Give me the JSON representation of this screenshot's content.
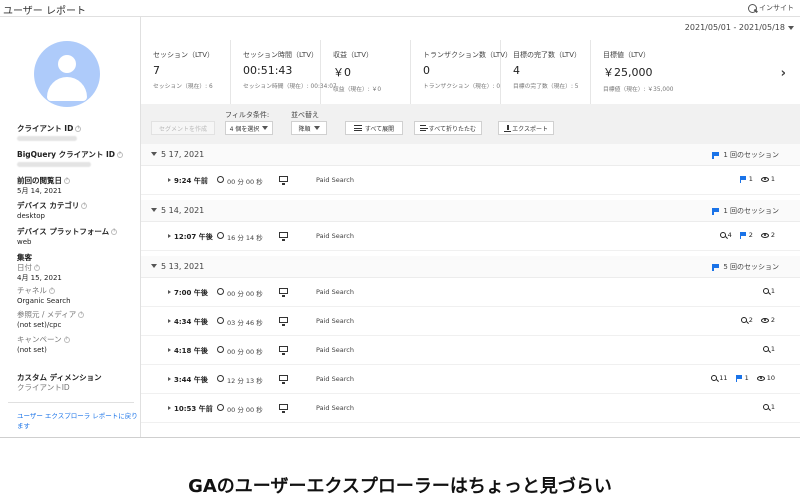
{
  "header": {
    "title": "ユーザー レポート",
    "insight": "インサイト"
  },
  "date_range": "2021/05/01 - 2021/05/18",
  "left_panel": {
    "client_id_label": "クライアント ID",
    "bq_client_id_label": "BigQuery クライアント ID",
    "first_visit_label": "前回の閲覧日",
    "first_visit_value": "5月 14, 2021",
    "device_category_label": "デバイス カテゴリ",
    "device_category_value": "desktop",
    "device_platform_label": "デバイス プラットフォーム",
    "device_platform_value": "web",
    "acquisition_label": "集客",
    "date_label": "日付",
    "date_value": "4月 15, 2021",
    "channel_label": "チャネル",
    "channel_value": "Organic Search",
    "source_medium_label": "参照元 / メディア",
    "source_medium_value": "(not set)/cpc",
    "campaign_label": "キャンペーン",
    "campaign_value": "(not set)",
    "custom_dim_label": "カスタム ディメンション",
    "custom_dim_sub": "クライアントID",
    "back_link": "ユーザー エクスプローラ レポートに戻ります"
  },
  "metrics": [
    {
      "label": "セッション（LTV）",
      "value": "7",
      "sub": "セッション（現在）: 6"
    },
    {
      "label": "セッション時間（LTV）",
      "value": "00:51:43",
      "sub": "セッション時間（現在）: 00:34:07"
    },
    {
      "label": "収益（LTV）",
      "value": "￥0",
      "sub": "収益（現在）: ￥0"
    },
    {
      "label": "トランザクション数（LTV）",
      "value": "0",
      "sub": "トランザクション（現在）: 0"
    },
    {
      "label": "目標の完了数（LTV）",
      "value": "4",
      "sub": "目標の完了数（現在）: 5"
    },
    {
      "label": "目標値（LTV）",
      "value": "￥25,000",
      "sub": "目標値（現在）: ￥35,000"
    }
  ],
  "metrics_next": "›",
  "toolbar": {
    "segment_button": "セグメントを作成",
    "filter_label": "フィルタ条件:",
    "filter_value": "4 個を選択",
    "sort_label": "並べ替え",
    "sort_value": "降順",
    "expand_all": "すべて展開",
    "collapse_all": "すべて折りたたむ",
    "export": "エクスポート"
  },
  "groups": [
    {
      "date": "5 17, 2021",
      "count": "1 回のセッション",
      "sessions": [
        {
          "time": "9:24 午前",
          "duration": "00 分 00 秒",
          "channel": "Paid Search",
          "zoom": "",
          "flag": "1",
          "eye": "1"
        }
      ]
    },
    {
      "date": "5 14, 2021",
      "count": "1 回のセッション",
      "sessions": [
        {
          "time": "12:07 午後",
          "duration": "16 分 14 秒",
          "channel": "Paid Search",
          "zoom": "4",
          "flag": "2",
          "eye": "2"
        }
      ]
    },
    {
      "date": "5 13, 2021",
      "count": "5 回のセッション",
      "sessions": [
        {
          "time": "7:00 午後",
          "duration": "00 分 00 秒",
          "channel": "Paid Search",
          "zoom": "1",
          "flag": "",
          "eye": ""
        },
        {
          "time": "4:34 午後",
          "duration": "03 分 46 秒",
          "channel": "Paid Search",
          "zoom": "2",
          "flag": "",
          "eye": "2"
        },
        {
          "time": "4:18 午後",
          "duration": "00 分 00 秒",
          "channel": "Paid Search",
          "zoom": "1",
          "flag": "",
          "eye": ""
        },
        {
          "time": "3:44 午後",
          "duration": "12 分 13 秒",
          "channel": "Paid Search",
          "zoom": "11",
          "flag": "1",
          "eye": "10"
        },
        {
          "time": "10:53 午前",
          "duration": "00 分 00 秒",
          "channel": "Paid Search",
          "zoom": "1",
          "flag": "",
          "eye": ""
        }
      ]
    }
  ],
  "caption": "GAのユーザーエクスプローラーはちょっと見づらい",
  "colors": {
    "accent": "#1a73e8",
    "avatar": "#aecbfa",
    "toolbar_bg": "#f1f1f1"
  }
}
